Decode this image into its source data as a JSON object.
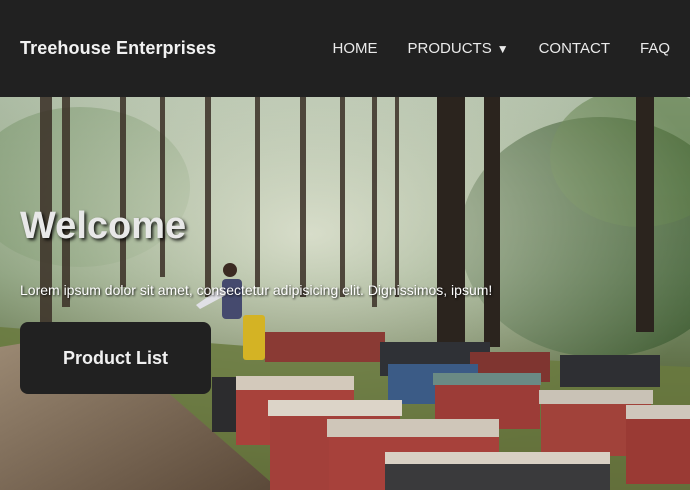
{
  "header": {
    "brand": "Treehouse Enterprises",
    "nav": [
      {
        "label": "HOME"
      },
      {
        "label": "PRODUCTS",
        "has_dropdown": true,
        "caret": "▼"
      },
      {
        "label": "CONTACT"
      },
      {
        "label": "FAQ"
      }
    ]
  },
  "hero": {
    "title": "Welcome",
    "tagline": "Lorem ipsum dolor sit amet, consectetur adipisicing elit. Dignissimos, ipsum!",
    "button_label": "Product List",
    "image_description_icon": "beehive-forest-photo"
  },
  "colors": {
    "nav_bg": "#212121",
    "nav_text": "#eaeaea",
    "button_bg": "#212121"
  }
}
